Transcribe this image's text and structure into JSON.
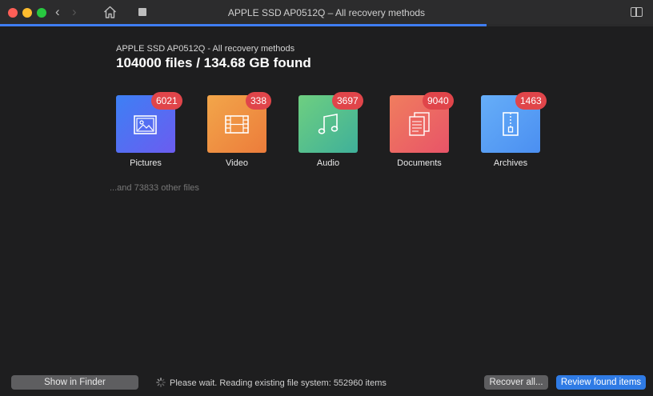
{
  "window": {
    "title": "APPLE SSD AP0512Q – All recovery methods",
    "back_glyph": "‹",
    "forward_glyph": "›",
    "progress_fraction": 0.745
  },
  "scan": {
    "subtitle": "APPLE SSD AP0512Q - All recovery methods",
    "headline": "104000 files / 134.68 GB found",
    "other_files": "...and 73833 other files"
  },
  "categories": [
    {
      "label": "Pictures",
      "count": "6021",
      "icon": "image-icon",
      "gradient": [
        "#3d80f4",
        "#6b5cf0"
      ]
    },
    {
      "label": "Video",
      "count": "338",
      "icon": "film-icon",
      "gradient": [
        "#f2a64a",
        "#ec7c3b"
      ]
    },
    {
      "label": "Audio",
      "count": "3697",
      "icon": "music-note-icon",
      "gradient": [
        "#6ecf80",
        "#3fb09a"
      ]
    },
    {
      "label": "Documents",
      "count": "9040",
      "icon": "document-icon",
      "gradient": [
        "#f07d5e",
        "#e85468"
      ]
    },
    {
      "label": "Archives",
      "count": "1463",
      "icon": "zip-archive-icon",
      "gradient": [
        "#66aef8",
        "#4b8ff1"
      ]
    }
  ],
  "footer": {
    "show_in_finder": "Show in Finder",
    "status": "Please wait. Reading existing file system: 552960 items",
    "recover_all": "Recover all...",
    "review": "Review found items"
  },
  "colors": {
    "accent": "#3f7df2",
    "badge": "#e0454a"
  }
}
